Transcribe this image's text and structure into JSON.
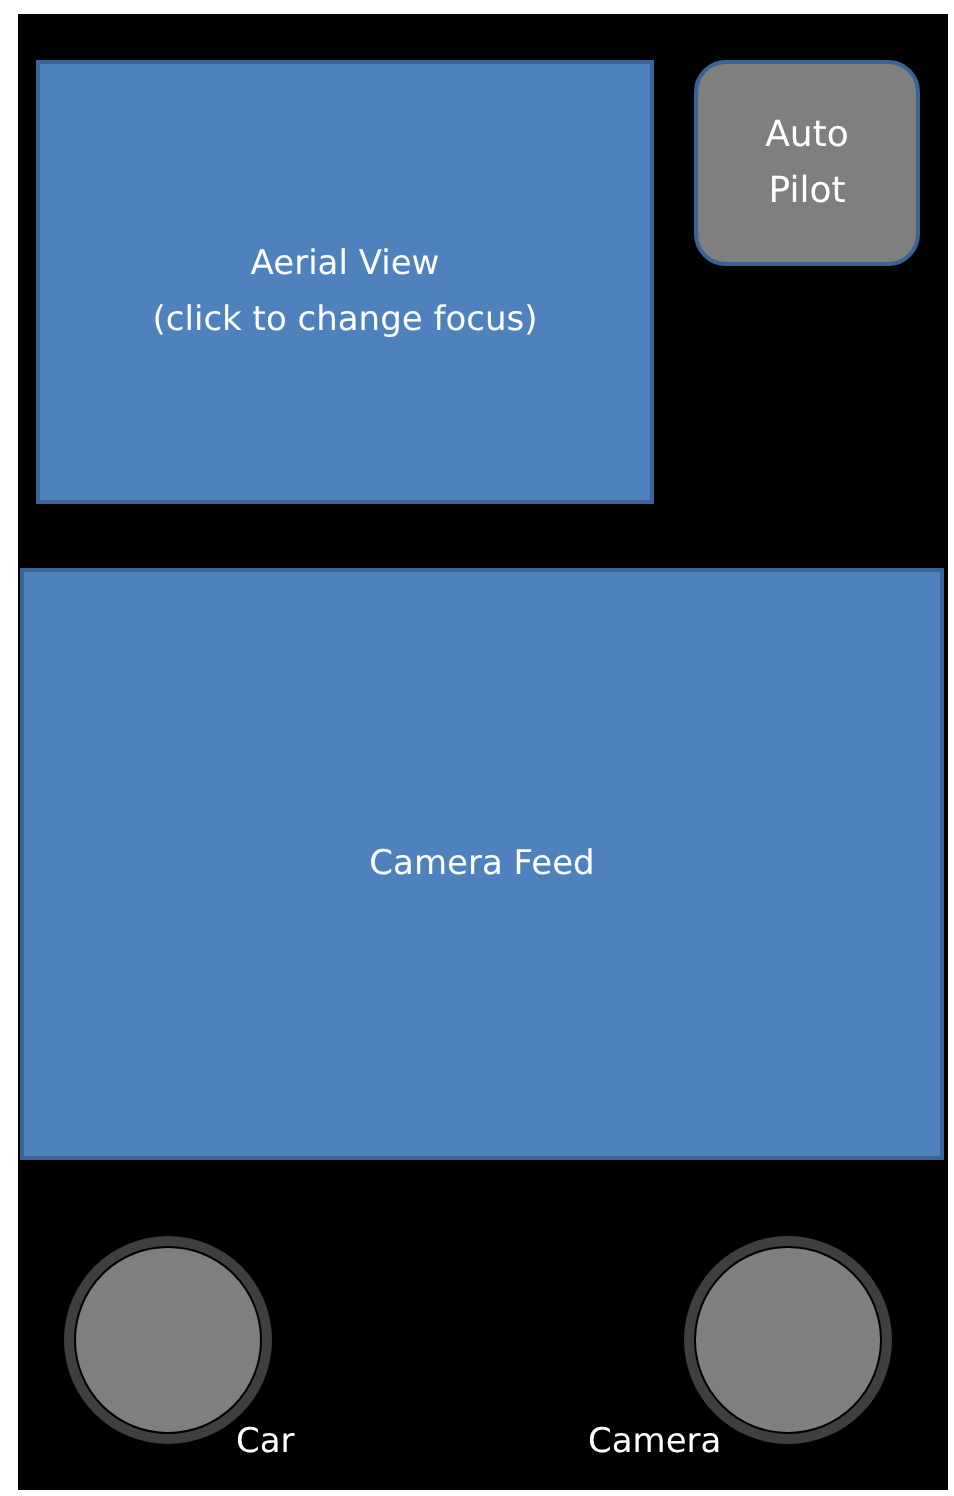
{
  "aerial_view": {
    "title": "Aerial View",
    "hint": "(click to change focus)"
  },
  "auto_pilot_button": {
    "label": "Auto Pilot"
  },
  "camera_feed": {
    "label": "Camera Feed"
  },
  "joysticks": [
    {
      "label": "Car"
    },
    {
      "label": "Camera"
    }
  ]
}
